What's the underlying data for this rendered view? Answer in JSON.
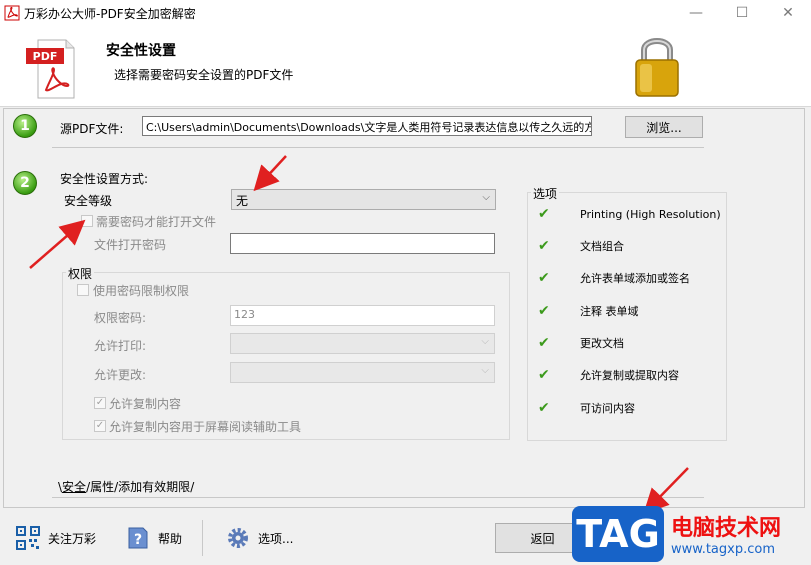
{
  "window": {
    "title": "万彩办公大师-PDF安全加密解密",
    "controls": {
      "minimize": "—",
      "maximize": "☐",
      "close": "✕"
    }
  },
  "header": {
    "title": "安全性设置",
    "subtitle": "选择需要密码安全设置的PDF文件",
    "pdf_badge": "PDF"
  },
  "step1": {
    "number": "1",
    "label": "源PDF文件:",
    "path": "C:\\Users\\admin\\Documents\\Downloads\\文字是人类用符号记录表达信息以传之久远的方:",
    "browse_label": "浏览..."
  },
  "step2": {
    "number": "2",
    "method_label": "安全性设置方式:",
    "level_label": "安全等级",
    "level_value": "无",
    "need_password_label": "需要密码才能打开文件",
    "open_password_label": "文件打开密码",
    "open_password_value": "",
    "permissions": {
      "group_label": "权限",
      "use_password_label": "使用密码限制权限",
      "password_label": "权限密码:",
      "password_value": "123",
      "print_label": "允许打印:",
      "change_label": "允许更改:",
      "allow_copy_label": "允许复制内容",
      "allow_copy_reader_label": "允许复制内容用于屏幕阅读辅助工具"
    },
    "options": {
      "group_label": "选项",
      "items": [
        "Printing (High Resolution)",
        "文档组合",
        "允许表单域添加或签名",
        "注释 表单域",
        "更改文档",
        "允许复制或提取内容",
        "可访问内容"
      ]
    }
  },
  "tabs": [
    {
      "label": "安全",
      "sep": "/"
    },
    {
      "label": "属性",
      "sep": "/"
    },
    {
      "label": "添加有效期限",
      "sep": "/"
    }
  ],
  "tabs_prefix": "\\",
  "bottom": {
    "follow_label": "关注万彩",
    "help_label": "帮助",
    "options_label": "选项...",
    "back_label": "返回"
  },
  "watermark": {
    "logo": "TAG",
    "title": "电脑技术网",
    "url": "www.tagxp.com"
  },
  "colors": {
    "accent_green": "#3c9a1c",
    "arrow_red": "#e02020",
    "tag_blue": "#1763c8"
  }
}
